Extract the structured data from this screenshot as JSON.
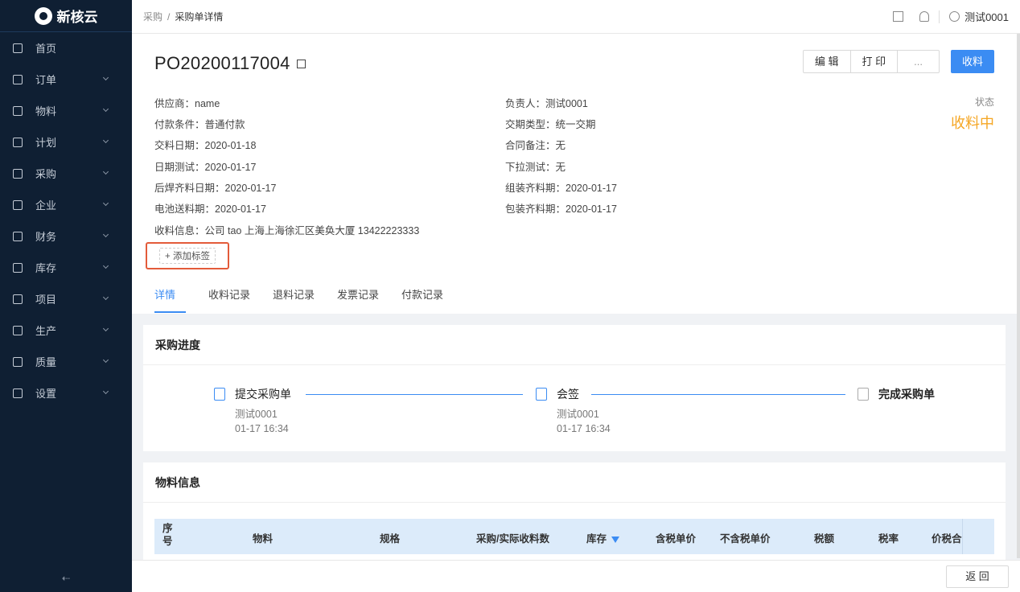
{
  "brand": {
    "name": "新核云"
  },
  "sidebar": {
    "items": [
      {
        "label": "首页",
        "icon": "home-icon"
      },
      {
        "label": "订单",
        "icon": "order-icon"
      },
      {
        "label": "物料",
        "icon": "material-icon"
      },
      {
        "label": "计划",
        "icon": "plan-icon"
      },
      {
        "label": "采购",
        "icon": "purchase-icon"
      },
      {
        "label": "企业",
        "icon": "enterprise-icon"
      },
      {
        "label": "财务",
        "icon": "finance-icon"
      },
      {
        "label": "库存",
        "icon": "inventory-icon"
      },
      {
        "label": "项目",
        "icon": "project-icon"
      },
      {
        "label": "生产",
        "icon": "production-icon"
      },
      {
        "label": "质量",
        "icon": "quality-icon"
      },
      {
        "label": "设置",
        "icon": "settings-icon"
      }
    ],
    "collapse_label": "⇠"
  },
  "header": {
    "breadcrumb_root": "采购",
    "breadcrumb_sep": "/",
    "breadcrumb_current": "采购单详情",
    "user": "测试0001"
  },
  "order": {
    "number": "PO20200117004",
    "actions": {
      "edit": "编 辑",
      "print": "打 印",
      "more": "...",
      "receive": "收料"
    },
    "status_label": "状态",
    "status_value": "收料中",
    "left": [
      "供应商：name",
      "付款条件：普通付款",
      "交料日期：2020-01-18",
      "日期测试：2020-01-17",
      "后焊齐料日期：2020-01-17",
      "电池送料期：2020-01-17",
      "收料信息：公司 tao 上海上海徐汇区美奂大厦 13422223333"
    ],
    "right": [
      "负责人：测试0001",
      "交期类型：统一交期",
      "合同备注：无",
      "下拉测试：无",
      "组装齐料期：2020-01-17",
      "包装齐料期：2020-01-17"
    ],
    "add_tag": "+  添加标签"
  },
  "tabs": [
    "详情",
    "收料记录",
    "退料记录",
    "发票记录",
    "付款记录"
  ],
  "progress": {
    "title": "采购进度",
    "steps": [
      {
        "name": "提交采购单",
        "user": "测试0001",
        "time": "01-17 16:34"
      },
      {
        "name": "会签",
        "user": "测试0001",
        "time": "01-17 16:34"
      },
      {
        "name": "完成采购单"
      }
    ]
  },
  "materials": {
    "title": "物料信息",
    "columns": [
      "序号",
      "物料",
      "规格",
      "采购/实际收料数",
      "库存",
      "含税单价",
      "不含税单价",
      "税额",
      "税率",
      "价税合"
    ]
  },
  "footer": {
    "back": "返 回"
  },
  "colors": {
    "sidebar": "#0f1f33",
    "primary": "#3b8cf3",
    "status": "#f5a623",
    "highlight": "#e35b3a"
  }
}
